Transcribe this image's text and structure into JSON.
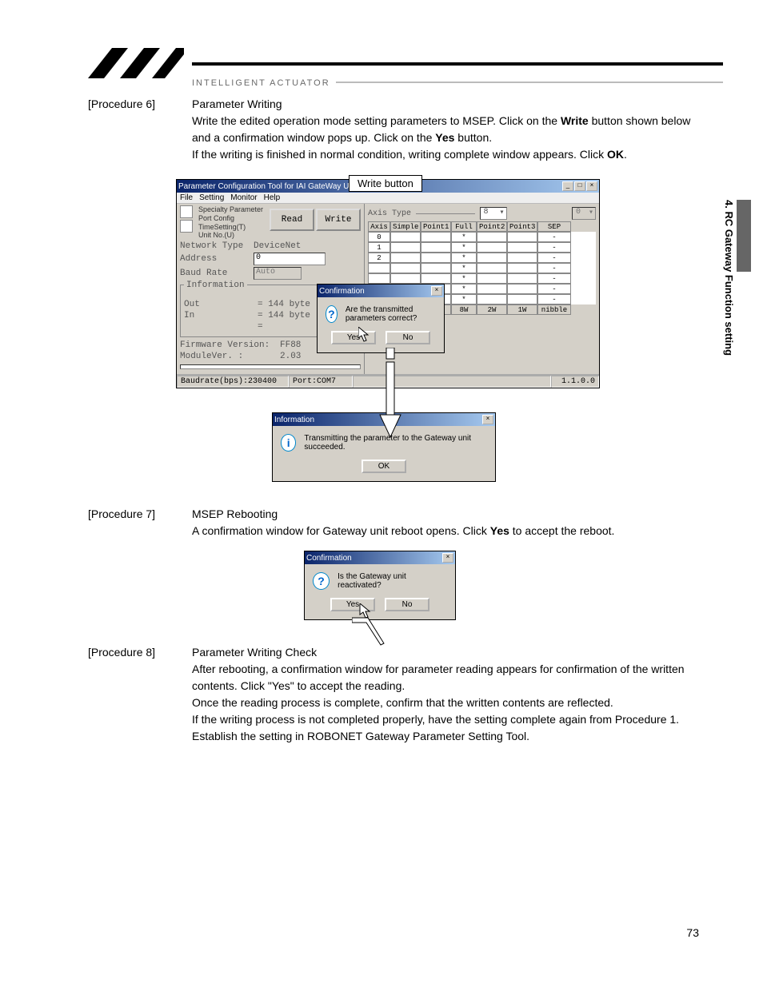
{
  "header": {
    "brand": "INTELLIGENT ACTUATOR"
  },
  "side_tab": "4. RC Gateway Function setting",
  "page_number": "73",
  "proc6": {
    "label": "[Procedure 6]",
    "title": "Parameter Writing",
    "p1a": "Write the edited operation mode setting parameters to MSEP. Click on the ",
    "p1b": "Write",
    "p1c": " button shown below and a confirmation window pops up. Click on the ",
    "p1d": "Yes",
    "p1e": " button.",
    "p2a": "If the writing is finished in normal condition, writing complete window appears. Click ",
    "p2b": "OK",
    "p2c": "."
  },
  "proc7": {
    "label": "[Procedure 7]",
    "title": "MSEP Rebooting",
    "p1a": "A confirmation window for Gateway unit reboot opens. Click ",
    "p1b": "Yes",
    "p1c": " to accept the reboot."
  },
  "proc8": {
    "label": "[Procedure 8]",
    "title": "Parameter Writing Check",
    "p1": "After rebooting, a confirmation window for parameter reading appears for confirmation of the written contents. Click \"Yes\" to accept the reading.",
    "p2": "Once the reading process is complete, confirm that the written contents are reflected.",
    "p3": "If the writing process is not completed properly, have the setting complete again from Procedure 1.",
    "p4": "Establish the setting in ROBONET Gateway Parameter Setting Tool."
  },
  "callout": {
    "write_button": "Write button"
  },
  "toolwin": {
    "title": "Parameter Configuration Tool for IAI GateWay U...",
    "menu": {
      "file": "File",
      "setting": "Setting",
      "monitor": "Monitor",
      "help": "Help"
    },
    "specialty": {
      "l1": "Specialty Parameter",
      "l2": "Port Config",
      "l3": "TimeSetting(T)",
      "l4": "Unit No.(U)"
    },
    "read": "Read",
    "write": "Write",
    "nettype_label": "Network Type",
    "nettype_value": "DeviceNet",
    "addr_label": "Address",
    "addr_value": "0",
    "baud_label": "Baud Rate",
    "baud_value": "Auto",
    "info_label": "Information",
    "out_label": "Out",
    "out_value": "= 144 byte",
    "in_label": "In",
    "in_value": "= 144 byte",
    "in_dash": "=",
    "fw_label": "Firmware Version:",
    "fw_value": "FF88",
    "mv_label": "ModuleVer. :",
    "mv_value": "2.03",
    "status_baud": "Baudrate(bps):230400",
    "status_port": "Port:COM7",
    "status_ver": "1.1.0.0",
    "axis_type_label": "Axis Type",
    "axis_type_value": "8",
    "axis_right_value": "0",
    "grid_cols": [
      "Axis",
      "Simple",
      "Point1",
      "Full",
      "Point2",
      "Point3",
      "SEP I/O"
    ],
    "grid_row0": [
      "0",
      "",
      "",
      "*",
      "",
      "",
      "-"
    ],
    "grid_row1": [
      "1",
      "",
      "",
      "*",
      "",
      "",
      "-"
    ],
    "grid_row2": [
      "2",
      "",
      "",
      "*",
      "",
      "",
      "-"
    ],
    "grid_row3": [
      "",
      "",
      "",
      "*",
      "",
      "",
      "-"
    ],
    "grid_row4": [
      "",
      "",
      "",
      "*",
      "",
      "",
      "-"
    ],
    "grid_row5": [
      "",
      "",
      "",
      "*",
      "",
      "",
      "-"
    ],
    "grid_row6": [
      "",
      "",
      "",
      "*",
      "",
      "",
      "-"
    ],
    "grid_foot": [
      "",
      "",
      "",
      "8W",
      "2W",
      "1W",
      "nibble"
    ]
  },
  "conf1": {
    "title": "Confirmation",
    "msg": "Are the transmitted parameters correct?",
    "yes": "Yes",
    "no": "No"
  },
  "info_dlg": {
    "title": "Information",
    "msg": "Transmitting the parameter to the Gateway unit succeeded.",
    "ok": "OK"
  },
  "conf2": {
    "title": "Confirmation",
    "msg": "Is the Gateway unit reactivated?",
    "yes": "Yes",
    "no": "No"
  }
}
